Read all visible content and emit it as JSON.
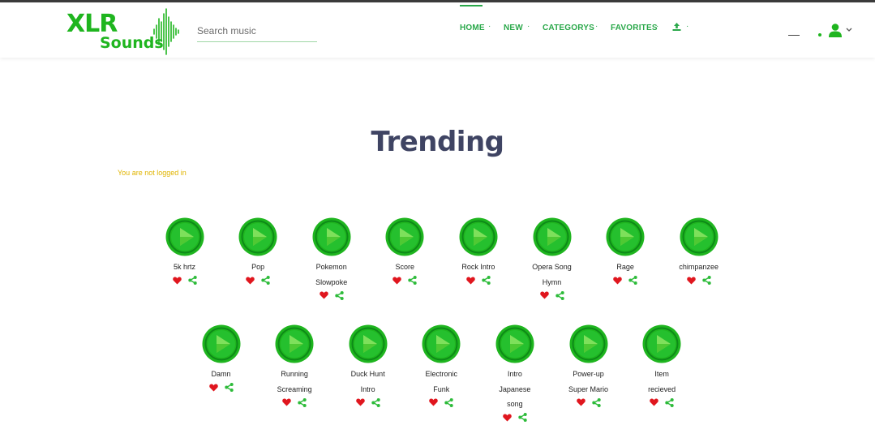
{
  "header": {
    "logo_top": "XLR",
    "logo_bottom": "Sounds",
    "search_placeholder": "Search music",
    "nav": [
      {
        "label": "HOME",
        "active": true
      },
      {
        "label": "NEW",
        "active": false
      },
      {
        "label": "CATEGORYS",
        "active": false
      },
      {
        "label": "FAVORITES",
        "active": false
      }
    ],
    "nav_separator": "·"
  },
  "main": {
    "title": "Trending",
    "login_status": "You are not logged in"
  },
  "sounds_row1": [
    {
      "name_lines": [
        "5k hrtz"
      ]
    },
    {
      "name_lines": [
        "Pop"
      ]
    },
    {
      "name_lines": [
        "Pokemon",
        "Slowpoke"
      ]
    },
    {
      "name_lines": [
        "Score"
      ]
    },
    {
      "name_lines": [
        "Rock Intro"
      ]
    },
    {
      "name_lines": [
        "Opera Song",
        "Hymn"
      ]
    },
    {
      "name_lines": [
        "Rage"
      ]
    },
    {
      "name_lines": [
        "chimpanzee"
      ]
    }
  ],
  "sounds_row2": [
    {
      "name_lines": [
        "Damn"
      ]
    },
    {
      "name_lines": [
        "Running",
        "Screaming"
      ]
    },
    {
      "name_lines": [
        "Duck Hunt",
        "Intro"
      ]
    },
    {
      "name_lines": [
        "Electronic",
        "Funk"
      ]
    },
    {
      "name_lines": [
        "Intro",
        "Japanese",
        "song"
      ]
    },
    {
      "name_lines": [
        "Power-up",
        "Super Mario"
      ]
    },
    {
      "name_lines": [
        "Item",
        "recieved"
      ]
    }
  ],
  "colors": {
    "brand_green": "#1fb51f",
    "nav_green": "#2aa84a",
    "title": "#3f4463",
    "warning": "#e0b400",
    "heart": "#e0161e",
    "share": "#2dbb3a"
  },
  "icons": {
    "play": "play-circle-icon",
    "like": "heart-icon",
    "share": "share-icon",
    "upload": "upload-icon",
    "user": "user-icon",
    "caret": "chevron-down-icon"
  }
}
